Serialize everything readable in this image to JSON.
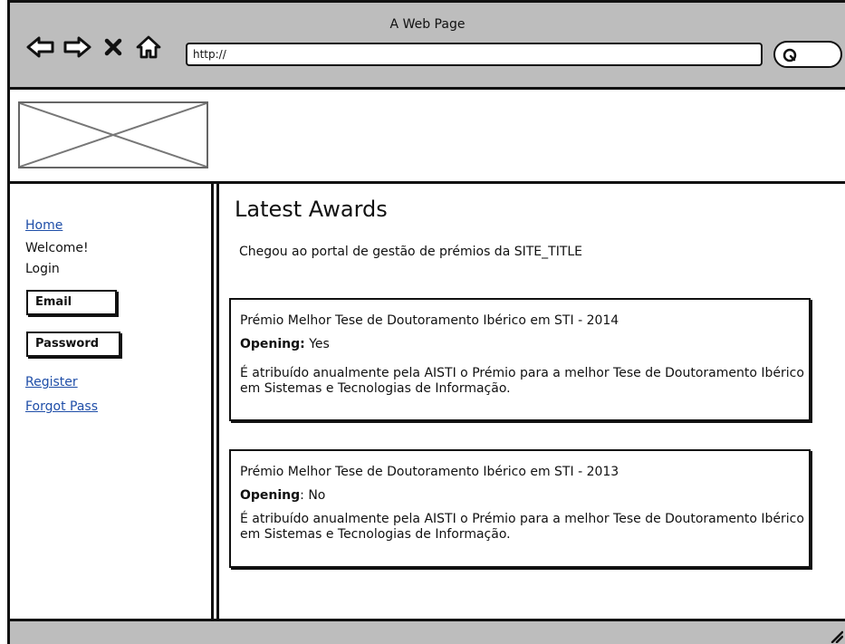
{
  "window": {
    "title": "A Web Page",
    "url": "http://"
  },
  "toolbar": {
    "icons": [
      "back-arrow-icon",
      "forward-arrow-icon",
      "stop-icon",
      "home-icon",
      "search-icon"
    ]
  },
  "sidebar": {
    "home_link": "Home",
    "welcome": "Welcome!",
    "login": "Login",
    "email_label": "Email",
    "password_label": "Password",
    "register_link": "Register",
    "forgot_link": "Forgot Pass"
  },
  "main": {
    "title": "Latest Awards",
    "intro": "Chegou ao portal de gestão de prémios da SITE_TITLE",
    "awards": [
      {
        "title": "Prémio Melhor Tese de Doutoramento Ibérico em STI - 2014",
        "opening_label": "Opening:",
        "opening_value": " Yes",
        "description": "É atribuído anualmente pela AISTI o Prémio para a melhor Tese de Doutoramento Ibérico em Sistemas e Tecnologias de Informação."
      },
      {
        "title": "Prémio Melhor Tese de Doutoramento Ibérico em STI - 2013",
        "opening_label": "Opening",
        "opening_value": ": No",
        "description": "É atribuído anualmente pela AISTI o Prémio para a melhor Tese de Doutoramento Ibérico em Sistemas e Tecnologias de Informação."
      }
    ]
  },
  "colors": {
    "link": "#1f4ea8",
    "chrome": "#bdbdbd",
    "border": "#111111"
  }
}
